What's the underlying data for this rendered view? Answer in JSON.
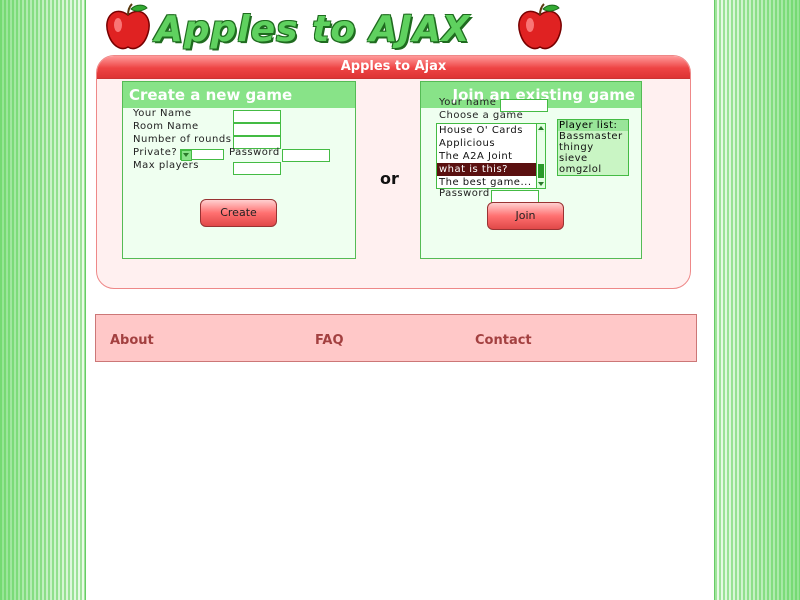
{
  "header": {
    "logo_text": "Apples to AJAX"
  },
  "panel": {
    "title": "Apples to Ajax",
    "or_text": "or",
    "create": {
      "heading": "Create a new game",
      "labels": {
        "your_name": "Your Name",
        "room_name": "Room Name",
        "rounds": "Number of rounds",
        "private": "Private?",
        "password": "Password",
        "max_players": "Max players"
      },
      "values": {
        "your_name": "",
        "room_name": "",
        "rounds": "",
        "private": "",
        "password": "",
        "max_players": ""
      },
      "button": "Create"
    },
    "join": {
      "heading": "Join an existing game",
      "labels": {
        "your_name": "Your name",
        "choose_game": "Choose a game",
        "password": "Password"
      },
      "values": {
        "your_name": "",
        "password": ""
      },
      "games": [
        "House O' Cards",
        "Applicious",
        "The A2A Joint",
        "what is this?",
        "The best game..."
      ],
      "selected_game": "what is this?",
      "players_heading": "Player list:",
      "players": [
        "Bassmaster",
        "thingy",
        "sieve",
        "omgzlol"
      ],
      "button": "Join"
    }
  },
  "footer": {
    "about": "About",
    "faq": "FAQ",
    "contact": "Contact"
  },
  "colors": {
    "accent_green": "#88e388",
    "panel_red": "#ee4444",
    "footer_pink": "#ffc8c8",
    "link_red": "#a34040"
  },
  "icons": [
    "apple-icon",
    "dropdown-arrow-icon",
    "scroll-up-icon",
    "scroll-down-icon"
  ]
}
